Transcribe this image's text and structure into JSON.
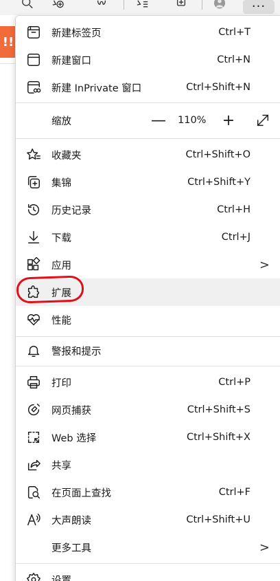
{
  "toolbar": {
    "icons": [
      "zoom-in-icon",
      "add-favorite-icon",
      "extensions-icon",
      "favorites-icon",
      "collections-icon",
      "profile-icon",
      "more-icon"
    ],
    "more_label": "···"
  },
  "page": {
    "tab_text": "!!"
  },
  "menu": {
    "new_tab": {
      "label": "新建标签页",
      "shortcut": "Ctrl+T"
    },
    "new_window": {
      "label": "新建窗口",
      "shortcut": "Ctrl+N"
    },
    "new_inprivate": {
      "label": "新建 InPrivate 窗口",
      "shortcut": "Ctrl+Shift+N"
    },
    "zoom": {
      "label": "缩放",
      "minus": "—",
      "value": "110%",
      "plus": "+"
    },
    "favorites": {
      "label": "收藏夹",
      "shortcut": "Ctrl+Shift+O"
    },
    "collections": {
      "label": "集锦",
      "shortcut": "Ctrl+Shift+Y"
    },
    "history": {
      "label": "历史记录",
      "shortcut": "Ctrl+H"
    },
    "downloads": {
      "label": "下载",
      "shortcut": "Ctrl+J"
    },
    "apps": {
      "label": "应用",
      "arrow": ">"
    },
    "extensions": {
      "label": "扩展"
    },
    "performance": {
      "label": "性能"
    },
    "alerts": {
      "label": "警报和提示"
    },
    "print": {
      "label": "打印",
      "shortcut": "Ctrl+P"
    },
    "web_capture": {
      "label": "网页捕获",
      "shortcut": "Ctrl+Shift+S"
    },
    "web_select": {
      "label": "Web 选择",
      "shortcut": "Ctrl+Shift+X"
    },
    "share": {
      "label": "共享"
    },
    "find": {
      "label": "在页面上查找",
      "shortcut": "Ctrl+F"
    },
    "read_aloud": {
      "label": "大声朗读",
      "shortcut": "Ctrl+Shift+U"
    },
    "more_tools": {
      "label": "更多工具",
      "arrow": ">"
    },
    "settings": {
      "label": "设置"
    }
  },
  "colors": {
    "accent_orange": "#f26b3a",
    "annotation_red": "#e0101a",
    "hover_bg": "#f0f0f0"
  }
}
